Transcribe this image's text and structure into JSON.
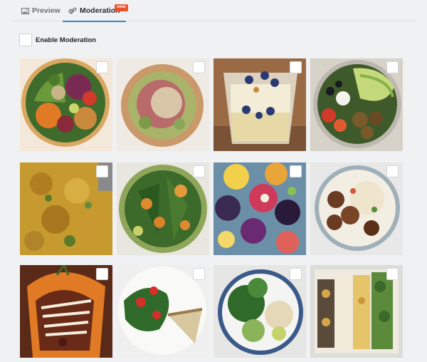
{
  "tabs": [
    {
      "label": "Preview",
      "icon": "image-icon",
      "active": false
    },
    {
      "label": "Moderation",
      "icon": "gears-icon",
      "active": true,
      "badge": "new"
    }
  ],
  "moderation": {
    "enable_label": "Enable Moderation",
    "enabled": false
  },
  "gallery": {
    "items": [
      {
        "subject": "colorful salad bowl",
        "selected": false
      },
      {
        "subject": "quinoa bowl",
        "selected": false
      },
      {
        "subject": "yogurt parfait with blueberries",
        "selected": false
      },
      {
        "subject": "falafel avocado bowl",
        "selected": false
      },
      {
        "subject": "curried rice",
        "selected": false
      },
      {
        "subject": "vegetable stew",
        "selected": false
      },
      {
        "subject": "smoothie bowls",
        "selected": false
      },
      {
        "subject": "rice with meatballs",
        "selected": false
      },
      {
        "subject": "stuffed pepper",
        "selected": false
      },
      {
        "subject": "salad and quiche",
        "selected": false
      },
      {
        "subject": "broccoli bowl",
        "selected": false
      },
      {
        "subject": "tray of vegetables",
        "selected": false
      }
    ]
  },
  "colors": {
    "accent": "#3b82c4",
    "badge": "#e8512c",
    "background": "#f0f1f3"
  }
}
